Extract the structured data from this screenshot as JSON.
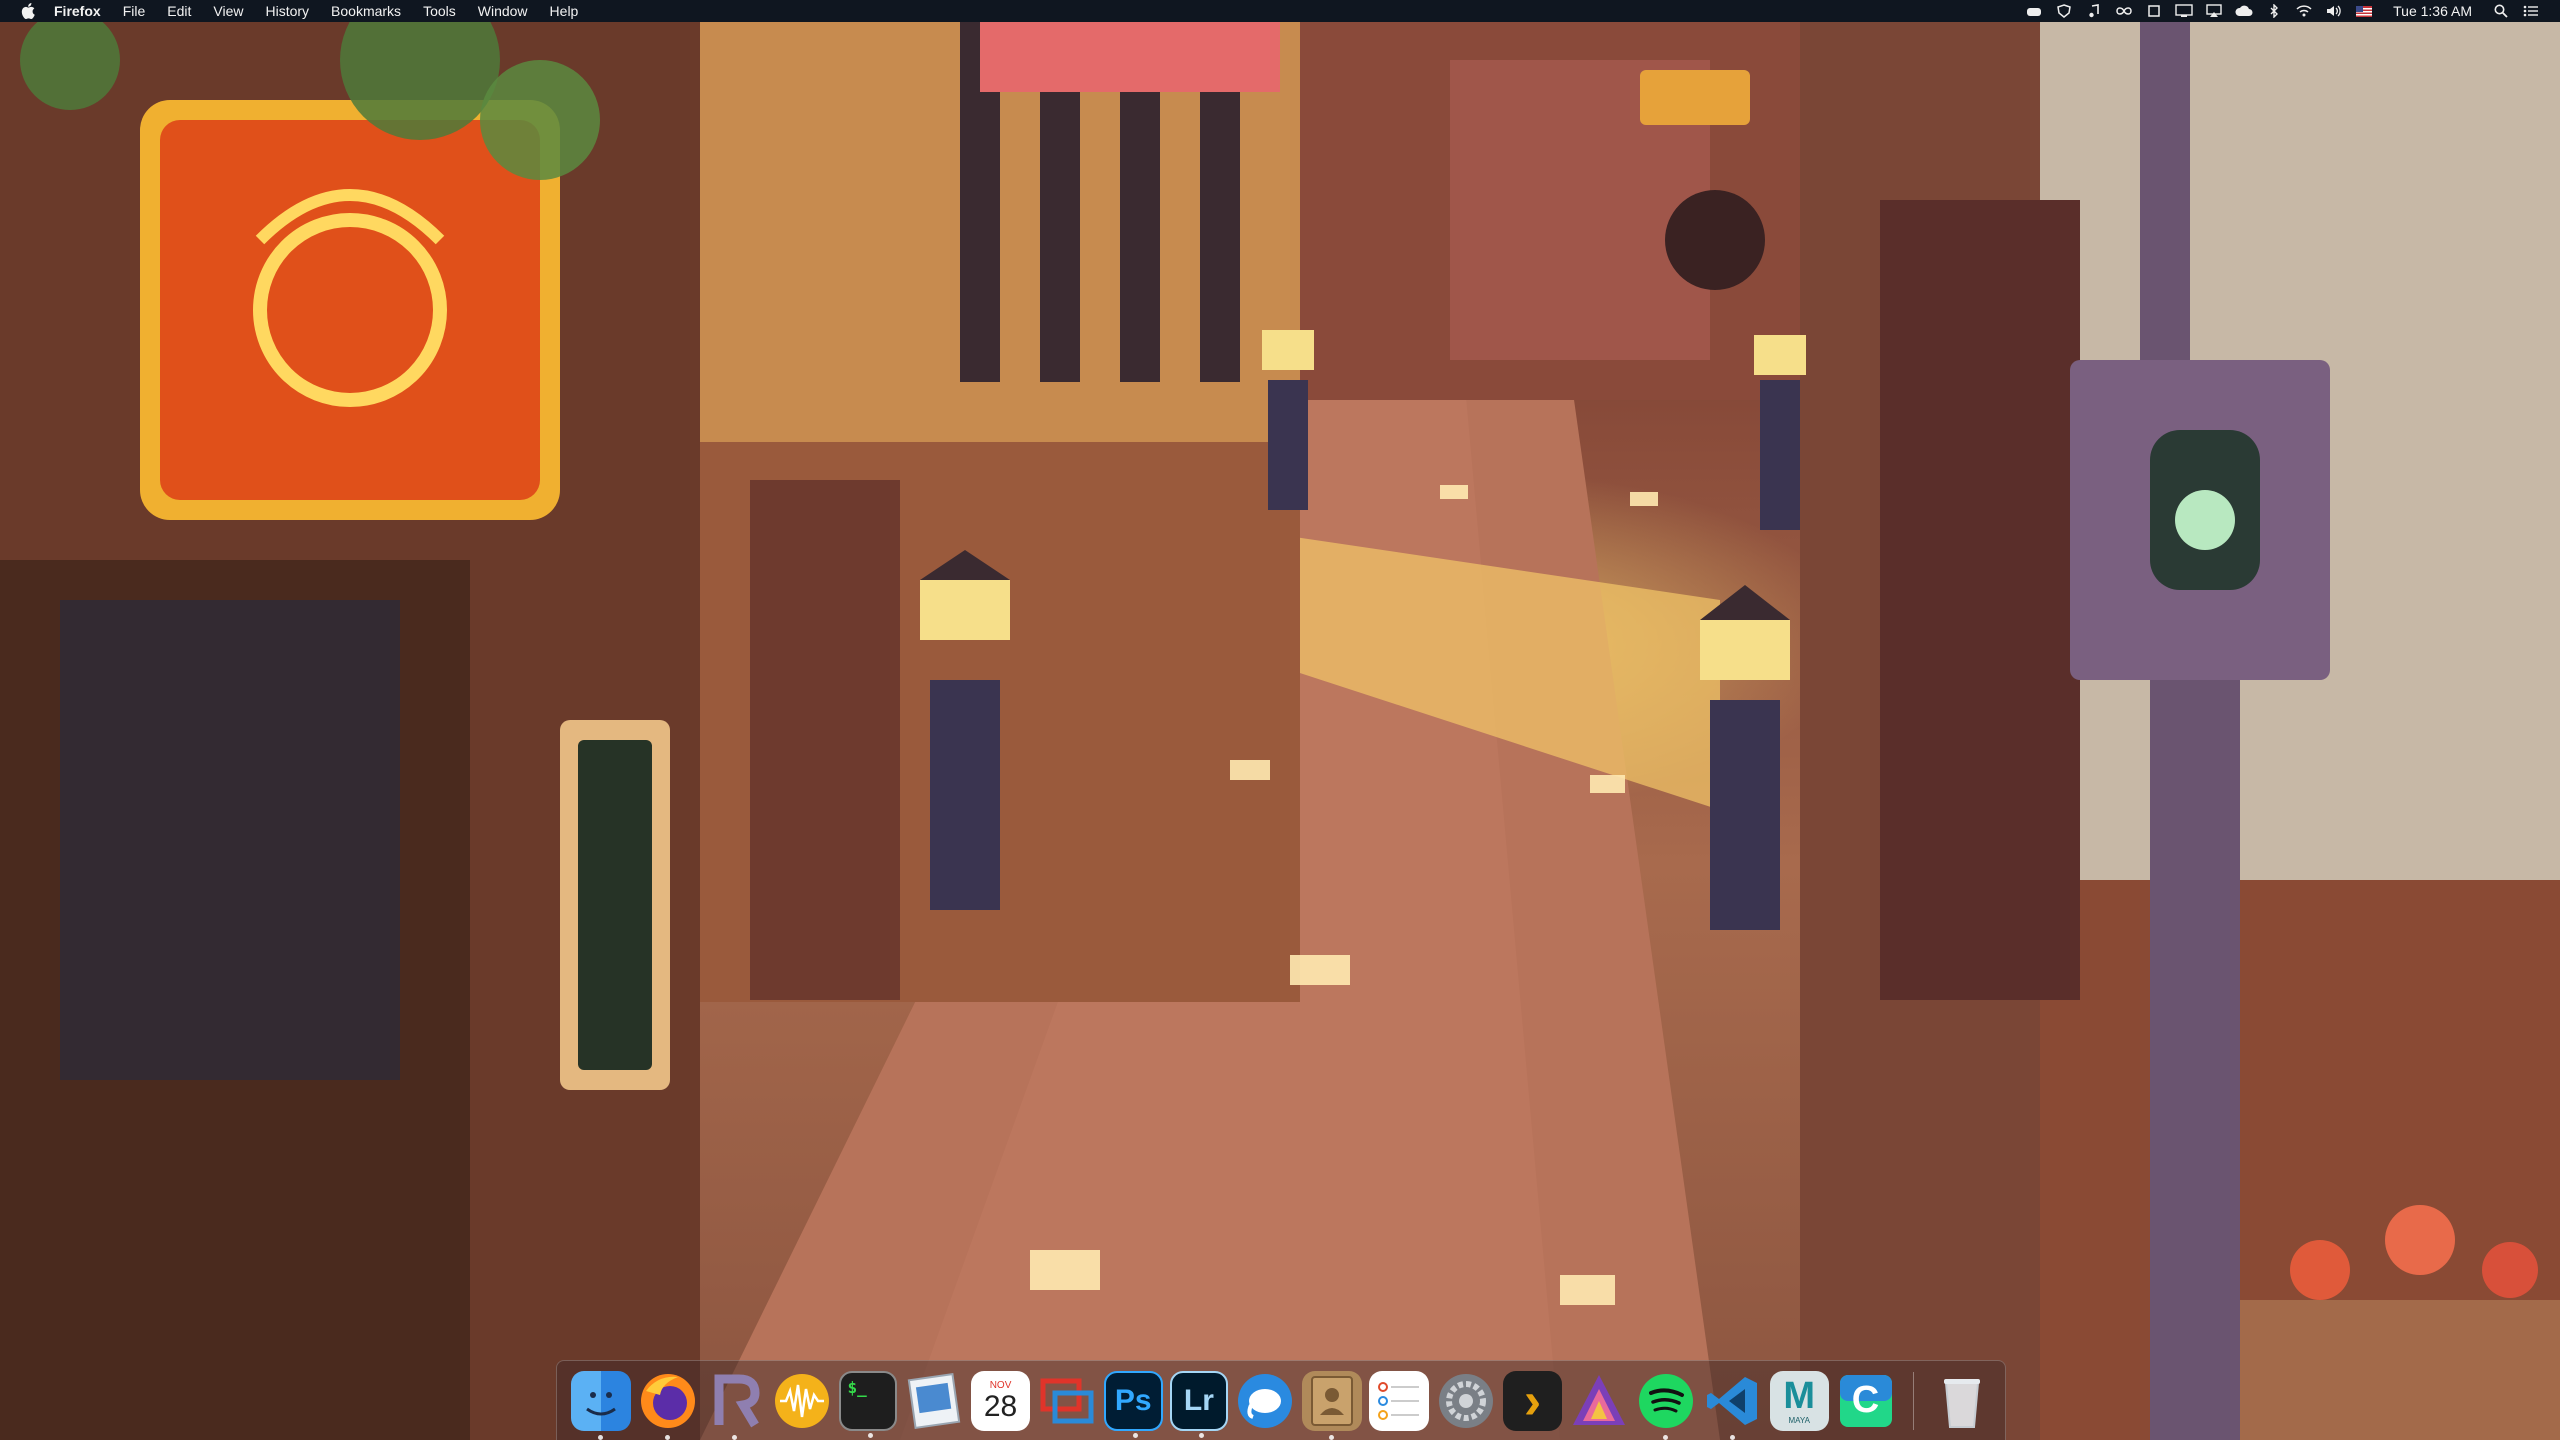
{
  "menubar": {
    "app_name": "Firefox",
    "menus": [
      "File",
      "Edit",
      "View",
      "History",
      "Bookmarks",
      "Tools",
      "Window",
      "Help"
    ],
    "status_icons": [
      "cloud-icon",
      "shield-icon",
      "music-note-icon",
      "infinity-icon",
      "square-icon",
      "display-icon",
      "airplay-icon",
      "creative-cloud-icon",
      "bluetooth-icon",
      "wifi-icon",
      "volume-icon",
      "us-flag-icon"
    ],
    "clock": "Tue 1:36 AM",
    "spotlight_icon": "search-icon",
    "notification_icon": "list-icon"
  },
  "dock": {
    "apps": [
      {
        "name": "Finder",
        "icon": "finder-icon",
        "running": true
      },
      {
        "name": "Firefox",
        "icon": "firefox-icon",
        "running": true
      },
      {
        "name": "Rider",
        "icon": "rider-icon",
        "running": true
      },
      {
        "name": "Audio",
        "icon": "waveform-icon",
        "running": false
      },
      {
        "name": "Terminal",
        "icon": "terminal-icon",
        "running": true
      },
      {
        "name": "Preview",
        "icon": "preview-icon",
        "running": false
      },
      {
        "name": "Calendar",
        "icon": "calendar-icon",
        "running": false
      },
      {
        "name": "Screens",
        "icon": "screens-icon",
        "running": false
      },
      {
        "name": "Photoshop",
        "icon": "photoshop-icon",
        "running": true
      },
      {
        "name": "Lightroom",
        "icon": "lightroom-icon",
        "running": true
      },
      {
        "name": "TablePlus",
        "icon": "elephant-icon",
        "running": false
      },
      {
        "name": "Contacts",
        "icon": "contacts-icon",
        "running": true
      },
      {
        "name": "Reminders",
        "icon": "reminders-icon",
        "running": false
      },
      {
        "name": "System Preferences",
        "icon": "gear-icon",
        "running": false
      },
      {
        "name": "Plex",
        "icon": "plex-icon",
        "running": false
      },
      {
        "name": "Affinity",
        "icon": "affinity-icon",
        "running": false
      },
      {
        "name": "Spotify",
        "icon": "spotify-icon",
        "running": true
      },
      {
        "name": "Visual Studio Code",
        "icon": "vscode-icon",
        "running": true
      },
      {
        "name": "Maya",
        "icon": "maya-icon",
        "running": false
      },
      {
        "name": "CLion",
        "icon": "clion-icon",
        "running": false
      }
    ],
    "trash": {
      "name": "Trash",
      "icon": "trash-icon"
    },
    "calendar": {
      "month": "NOV",
      "day": "28"
    },
    "labels": {
      "terminal": "$_",
      "photoshop": "Ps",
      "lightroom": "Lr",
      "maya": "M",
      "maya_sub": "MAYA",
      "plex": "›",
      "clion": "C"
    }
  }
}
